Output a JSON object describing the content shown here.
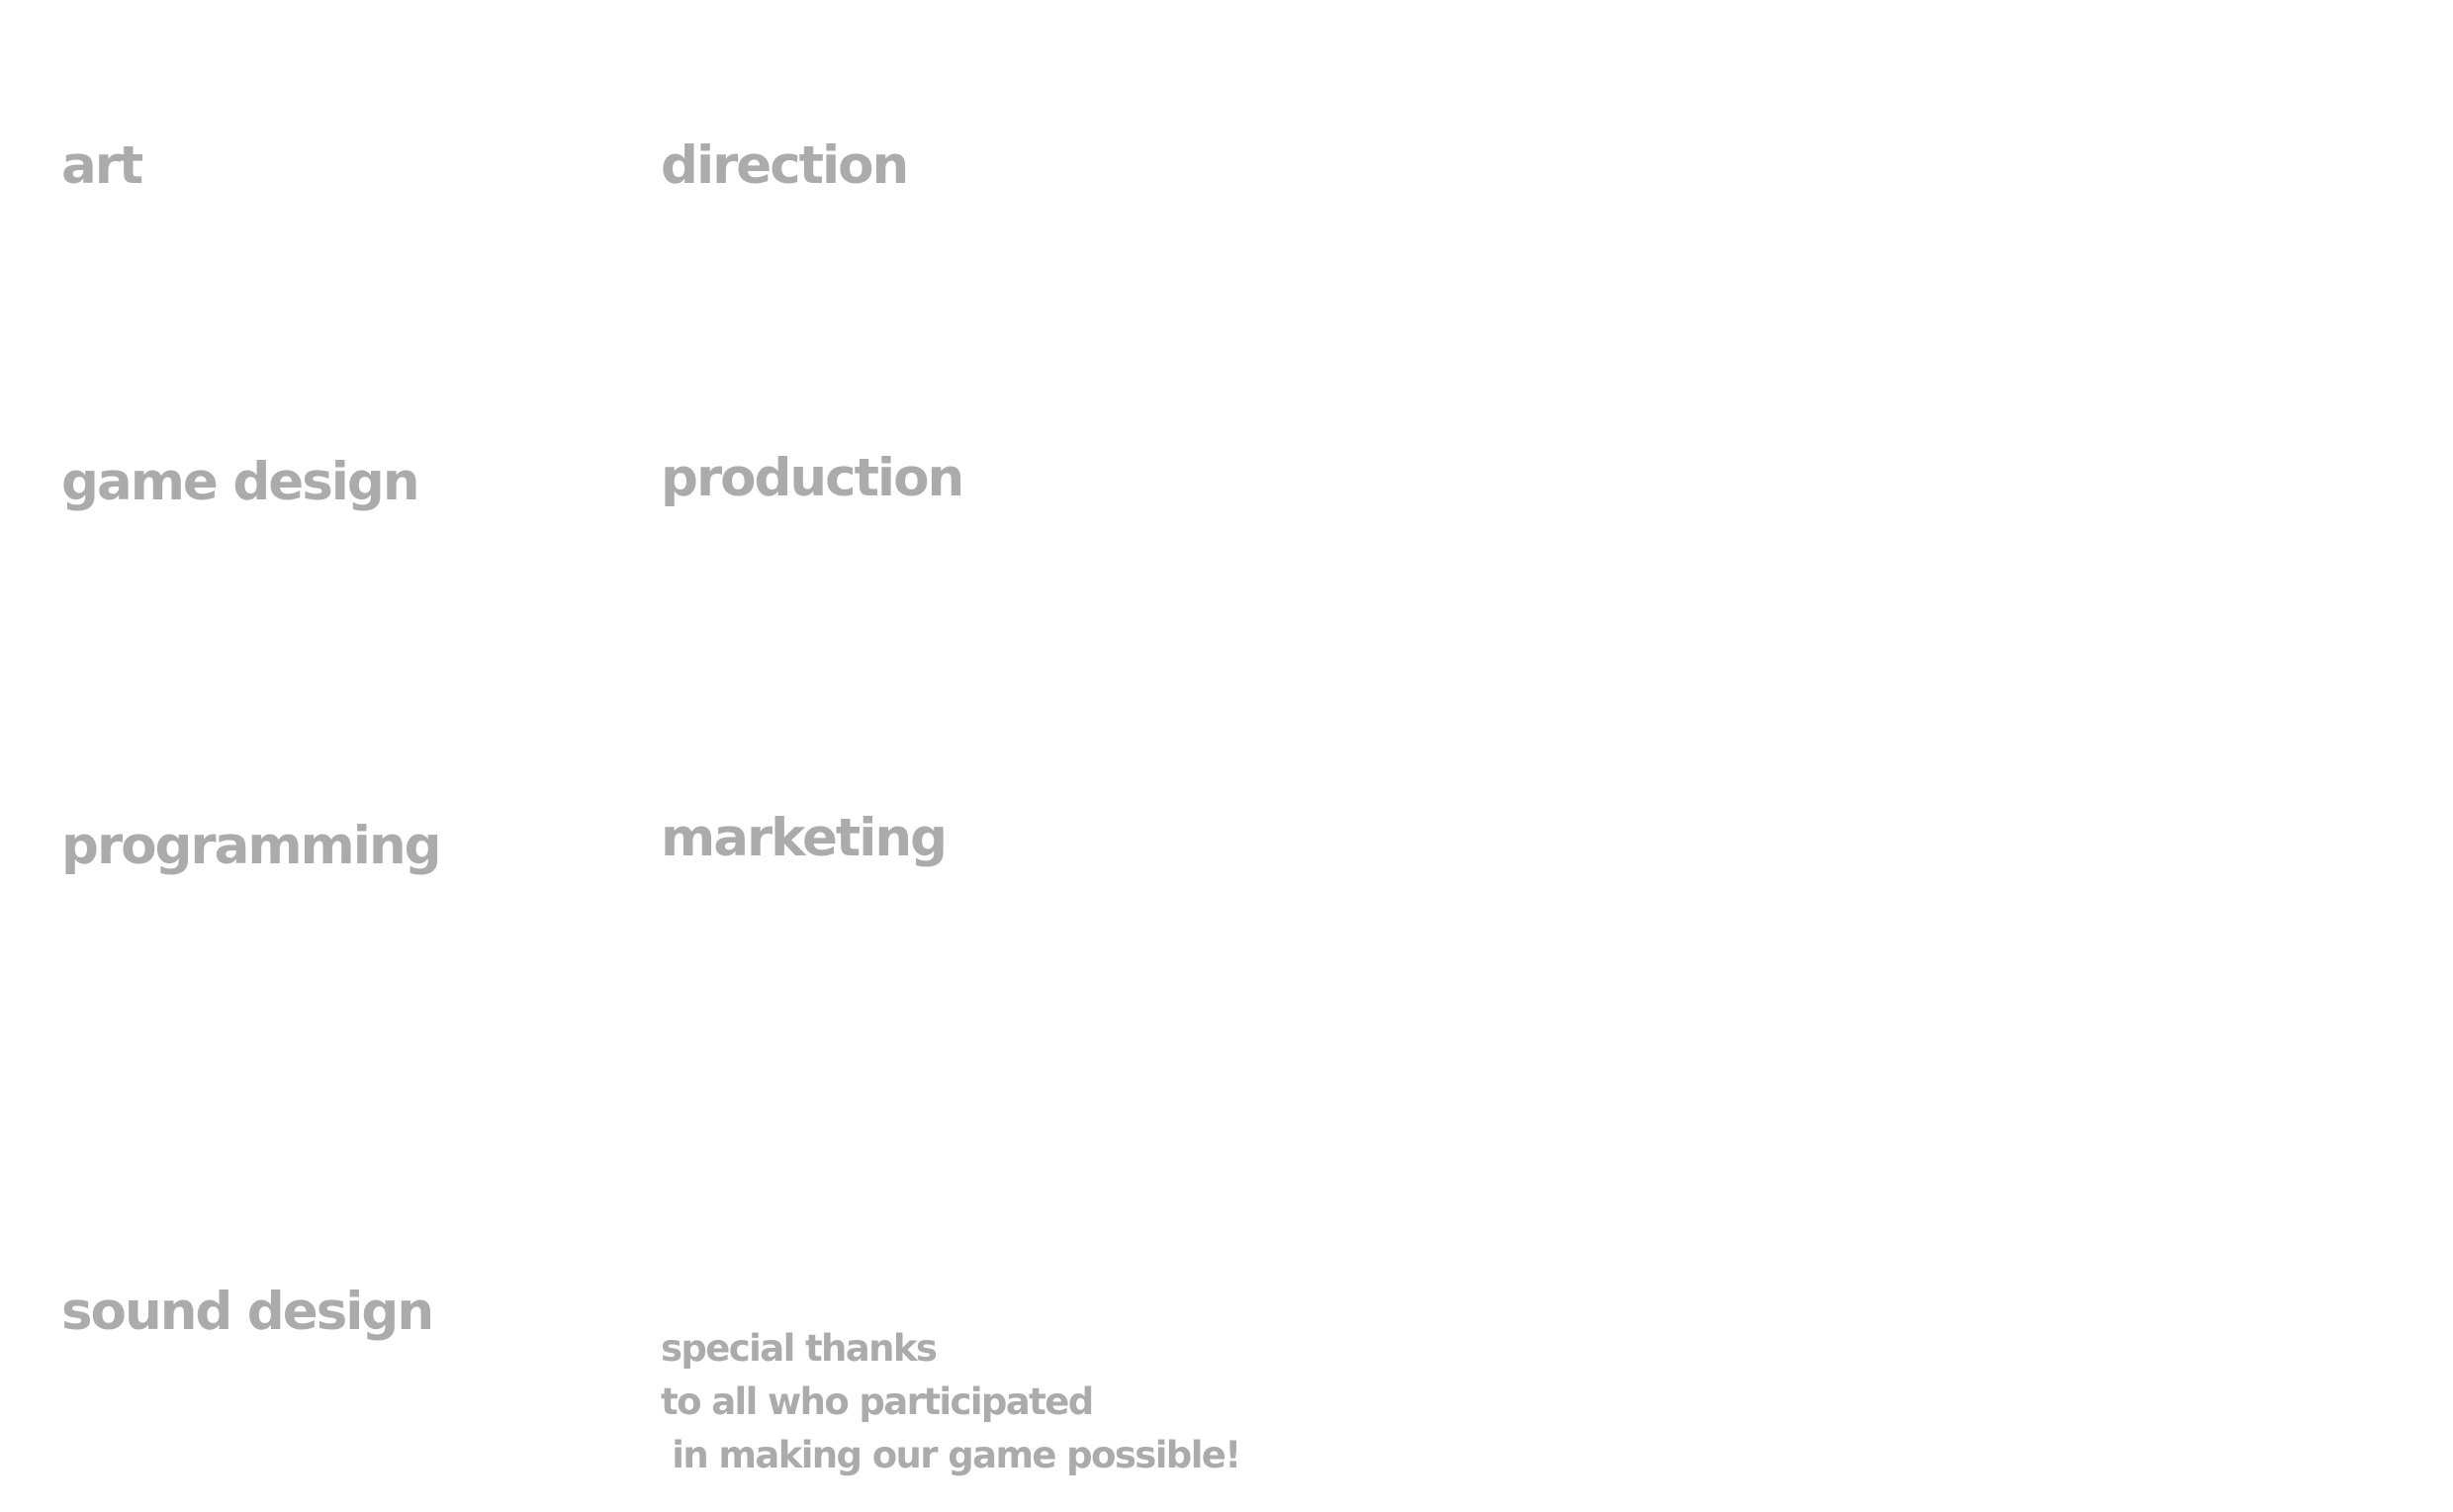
{
  "colors": {
    "background": "#ffffff",
    "text": "#ababab"
  },
  "sections": {
    "art": "art",
    "direction": "direction",
    "game_design": "game design",
    "production": "production",
    "programming": "programming",
    "marketing": "marketing",
    "sound_design": "sound design"
  },
  "special_thanks": {
    "lines": [
      "special thanks",
      "to all who participated",
      " in making our game possible!"
    ]
  }
}
